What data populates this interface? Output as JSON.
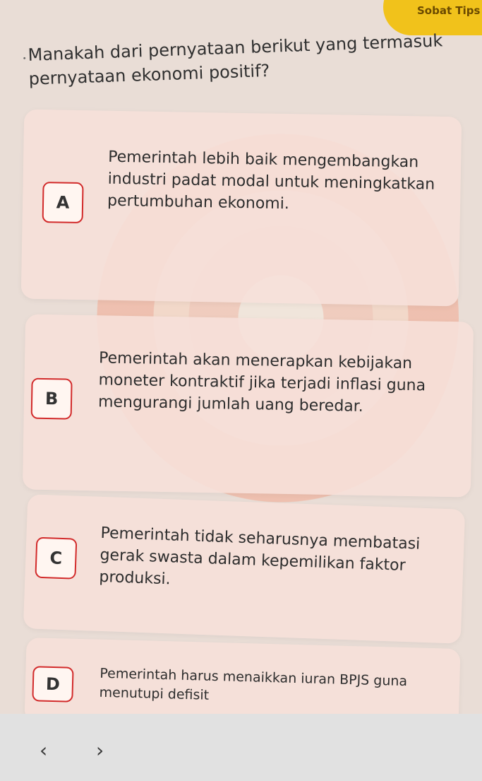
{
  "badge_label": "Sobat Tips",
  "question_text": "Manakah dari pernyataan berikut yang termasuk pernyataan ekonomi positif?",
  "options": [
    {
      "letter": "A",
      "text": "Pemerintah lebih baik mengembangkan industri padat modal untuk meningkatkan pertumbuhan ekonomi."
    },
    {
      "letter": "B",
      "text": "Pemerintah akan menerapkan kebijakan moneter kontraktif jika terjadi inflasi guna mengurangi jumlah uang beredar."
    },
    {
      "letter": "C",
      "text": "Pemerintah tidak seharusnya membatasi gerak swasta dalam kepemilikan faktor produksi."
    },
    {
      "letter": "D",
      "text": "Pemerintah harus menaikkan iuran BPJS guna menutupi defisit"
    }
  ],
  "nav": {
    "prev_label": "‹",
    "next_label": "›"
  }
}
